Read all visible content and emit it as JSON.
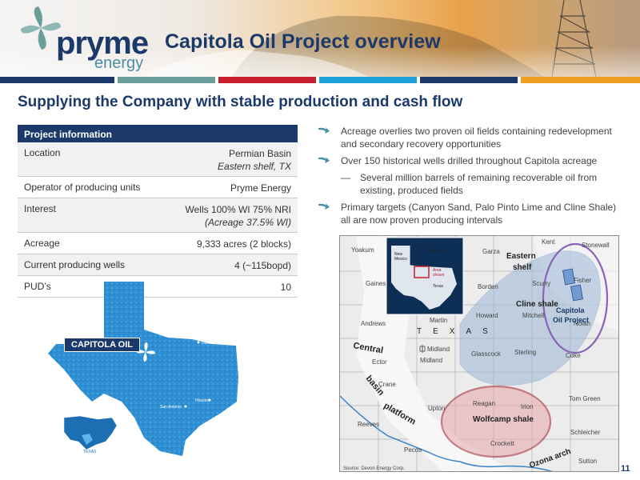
{
  "header": {
    "logo_word1": "pryme",
    "logo_word2": "energy",
    "title": "Capitola Oil Project overview"
  },
  "colors": {
    "navy": "#1b3a6b",
    "teal": "#6a9e9a",
    "red": "#c8202f",
    "cyan": "#1ea0d8",
    "orange": "#f0a020"
  },
  "subtitle": "Supplying the Company with stable production and cash flow",
  "project_info": {
    "header": "Project information",
    "rows": [
      {
        "label": "Location",
        "value": "Permian Basin",
        "sub": "Eastern shelf, TX"
      },
      {
        "label": "Operator of producing units",
        "value": "Pryme Energy",
        "sub": ""
      },
      {
        "label": "Interest",
        "value": "Wells 100% WI 75% NRI",
        "sub": "(Acreage 37.5% WI)"
      },
      {
        "label": "Acreage",
        "value": "9,333 acres (2 blocks)",
        "sub": ""
      },
      {
        "label": "Current producing wells",
        "value": "4 (~115bopd)",
        "sub": ""
      },
      {
        "label": "PUD’s",
        "value": "10",
        "sub": ""
      }
    ]
  },
  "bullets": [
    {
      "text": "Acreage overlies two proven oil fields containing redevelopment and secondary recovery opportunities",
      "type": "arrow"
    },
    {
      "text": "Over 150 historical wells drilled throughout Capitola acreage",
      "type": "arrow"
    },
    {
      "text": "Several million barrels of remaining recoverable oil from existing, produced fields",
      "type": "dash",
      "mark": "—"
    },
    {
      "text": "Primary targets (Canyon Sand, Palo Pinto Lime and Cline Shale) all are now proven producing intervals",
      "type": "arrow"
    }
  ],
  "texas_map": {
    "label": "CAPITOLA OIL",
    "cities": [
      "Dallas",
      "Houston",
      "San Antonio"
    ],
    "inset_label": "TEXAS"
  },
  "detail_map": {
    "counties": [
      "Yoakum",
      "Garza",
      "Kent",
      "Stonewall",
      "Gaines",
      "Borden",
      "Scurry",
      "Fisher",
      "Andrews",
      "Martin",
      "Howard",
      "Mitchell",
      "Nolan",
      "Glasscock",
      "Sterling",
      "Coke",
      "Ector",
      "Midland",
      "Crane",
      "Upton",
      "Reagan",
      "Irion",
      "Tom Green",
      "Reeves",
      "Schleicher",
      "Pecos",
      "Crockett",
      "Sutton"
    ],
    "regions": {
      "eastern_shelf": "Eastern shelf",
      "cline_shale": "Cline shale",
      "central_basin_platform": [
        "Central",
        "basin",
        "platform"
      ],
      "wolfcamp_shale": "Wolfcamp shale",
      "ozona_arch": "Ozona arch",
      "texas_letters": "T E X A S",
      "capitola_project": [
        "Capitola",
        "Oil Project"
      ]
    },
    "inset": {
      "new_mexico": [
        "New",
        "Mexico"
      ],
      "oklahoma": "Oklahoma",
      "texas": "Texas",
      "area_shown": [
        "Area",
        "shown"
      ]
    },
    "source": "Source: Devon Energy Corp."
  },
  "page_number": "11"
}
